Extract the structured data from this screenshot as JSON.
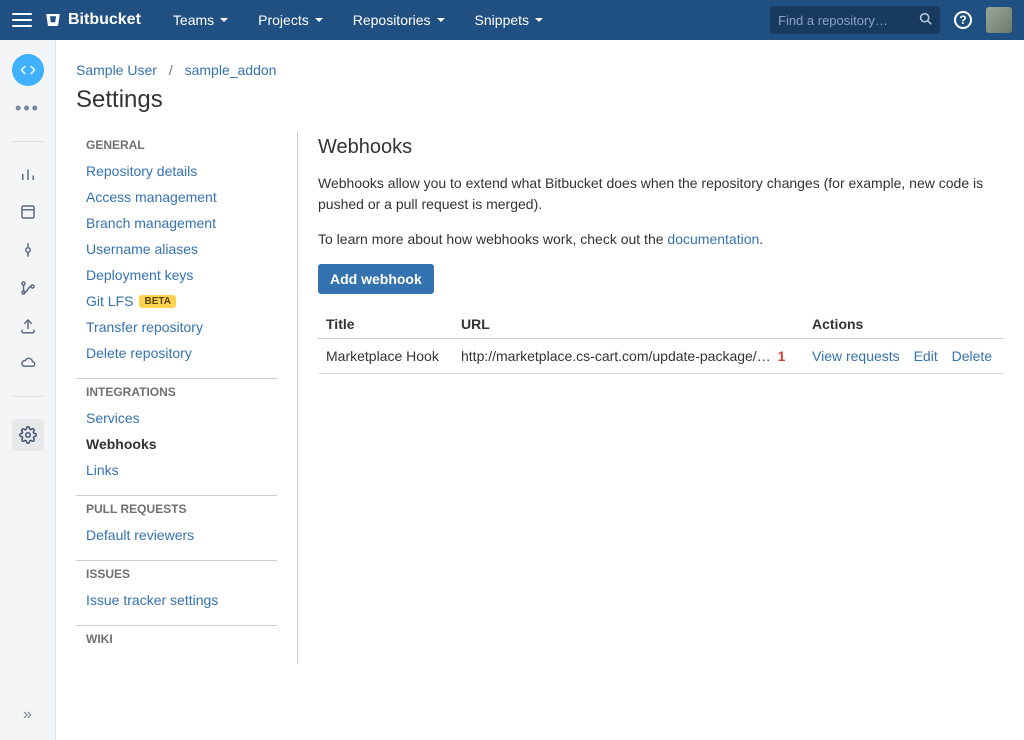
{
  "app": {
    "name": "Bitbucket",
    "search_placeholder": "Find a repository…"
  },
  "topnav": {
    "teams": "Teams",
    "projects": "Projects",
    "repositories": "Repositories",
    "snippets": "Snippets"
  },
  "breadcrumb": {
    "user": "Sample User",
    "repo": "sample_addon"
  },
  "page": {
    "title": "Settings"
  },
  "nav": {
    "general": {
      "heading": "GENERAL",
      "repo_details": "Repository details",
      "access_mgmt": "Access management",
      "branch_mgmt": "Branch management",
      "username_aliases": "Username aliases",
      "deployment_keys": "Deployment keys",
      "git_lfs": "Git LFS",
      "git_lfs_badge": "BETA",
      "transfer_repo": "Transfer repository",
      "delete_repo": "Delete repository"
    },
    "integrations": {
      "heading": "INTEGRATIONS",
      "services": "Services",
      "webhooks": "Webhooks",
      "links": "Links"
    },
    "pull_requests": {
      "heading": "PULL REQUESTS",
      "default_reviewers": "Default reviewers"
    },
    "issues": {
      "heading": "ISSUES",
      "tracker_settings": "Issue tracker settings"
    },
    "wiki": {
      "heading": "WIKI"
    }
  },
  "panel": {
    "title": "Webhooks",
    "desc1": "Webhooks allow you to extend what Bitbucket does when the repository changes (for example, new code is pushed or a pull request is merged).",
    "desc2_prefix": "To learn more about how webhooks work, check out the ",
    "desc2_link": "documentation",
    "desc2_suffix": ".",
    "add_button": "Add webhook",
    "table": {
      "th_title": "Title",
      "th_url": "URL",
      "th_actions": "Actions",
      "rows": [
        {
          "title": "Marketplace Hook",
          "url": "http://marketplace.cs-cart.com/update-package/…",
          "badge": "1",
          "view_requests": "View requests",
          "edit": "Edit",
          "delete": "Delete"
        }
      ]
    }
  }
}
